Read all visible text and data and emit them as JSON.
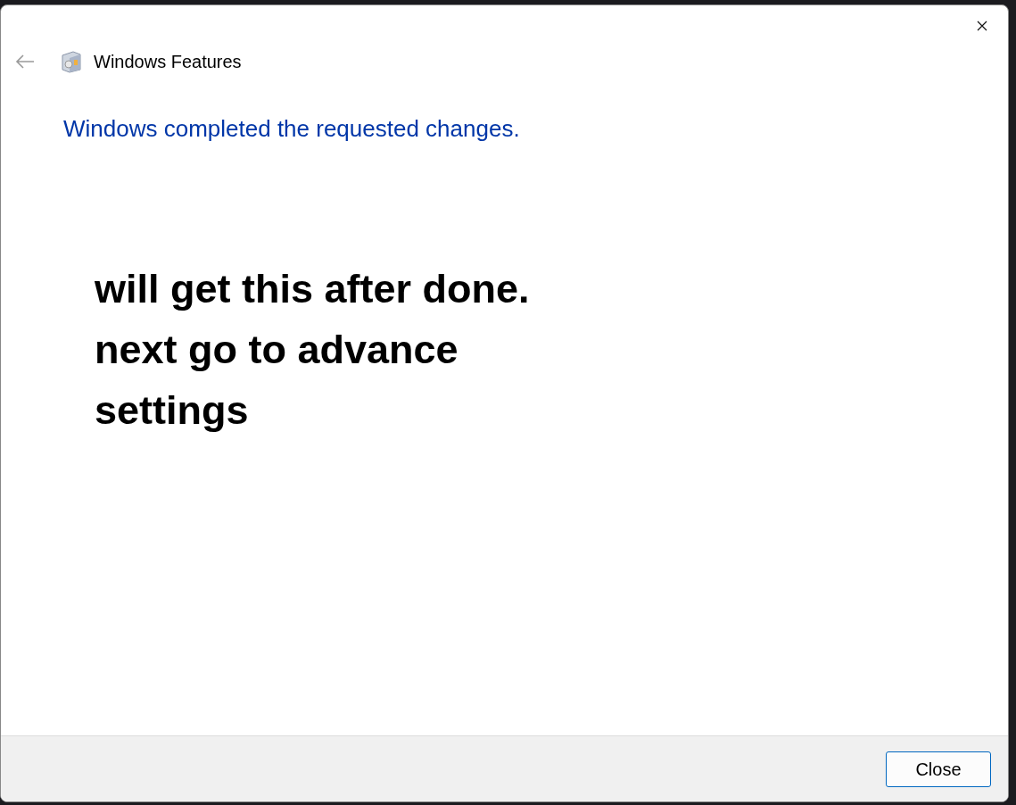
{
  "window": {
    "title": "Windows Features"
  },
  "heading": "Windows completed the requested changes.",
  "annotation": [
    "will get this after done.",
    "next go to advance",
    "settings"
  ],
  "buttons": [
    "Close"
  ]
}
